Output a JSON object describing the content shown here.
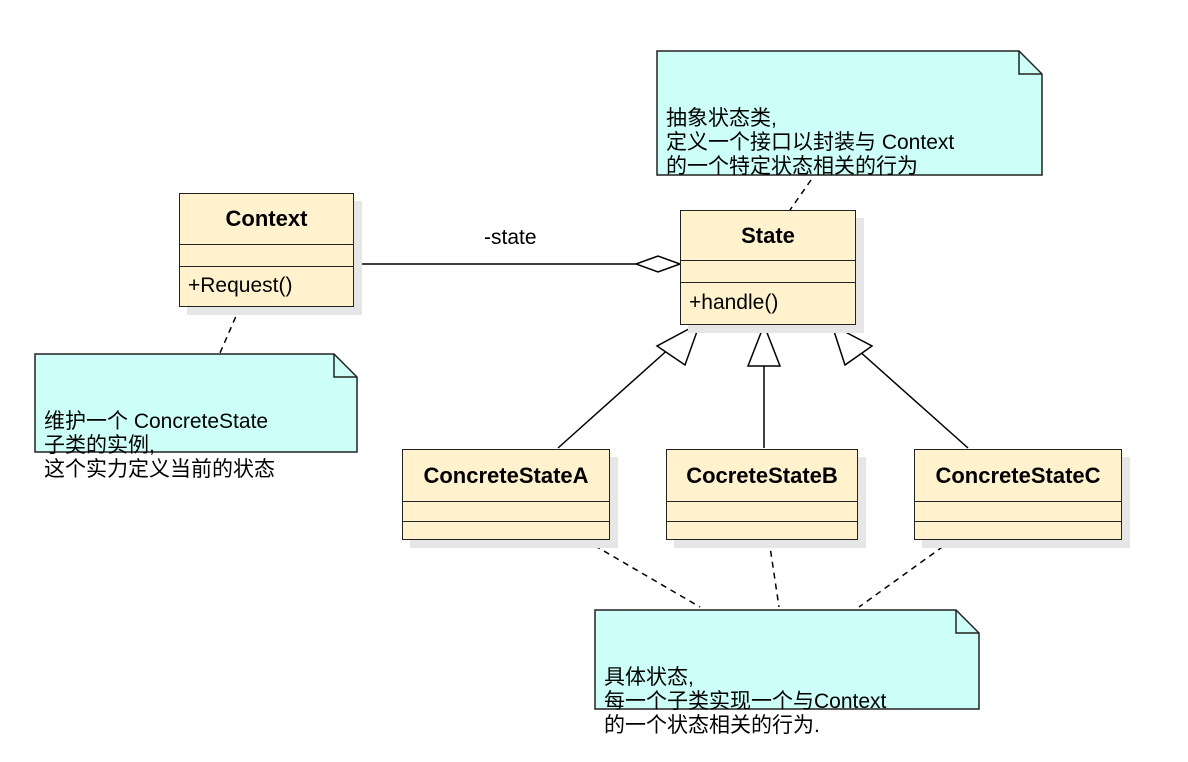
{
  "classes": {
    "context": {
      "name": "Context",
      "op": "+Request()"
    },
    "state": {
      "name": "State",
      "op": "+handle()"
    },
    "concrete_a": {
      "name": "ConcreteStateA"
    },
    "concrete_b": {
      "name": "CocreteStateB"
    },
    "concrete_c": {
      "name": "ConcreteStateC"
    }
  },
  "association": {
    "label": "-state"
  },
  "notes": {
    "state_note": "抽象状态类,\n定义一个接口以封装与 Context\n的一个特定状态相关的行为",
    "context_note": "维护一个 ConcreteState\n子类的实例,\n这个实力定义当前的状态",
    "concrete_note": "具体状态,\n每一个子类实现一个与Context\n的一个状态相关的行为."
  },
  "colors": {
    "class_fill": "#fff2cc",
    "note_fill": "#ccfff7",
    "line": "#000000"
  }
}
